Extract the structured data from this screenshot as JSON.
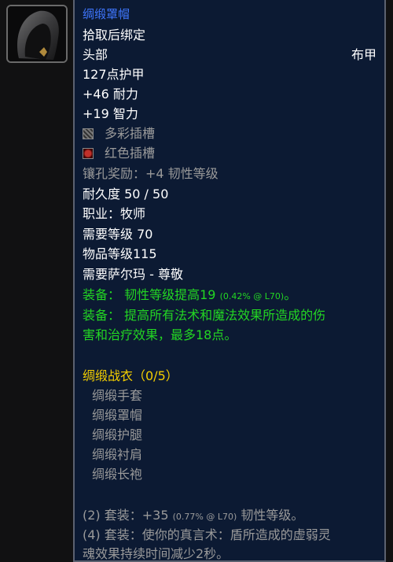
{
  "item": {
    "name": "绸缎罩帽",
    "bind": "拾取后绑定",
    "slot": "头部",
    "armor_type": "布甲",
    "armor": "127点护甲",
    "stamina": "+46 耐力",
    "intellect": "+19 智力",
    "socket1": "多彩插槽",
    "socket2": "红色插槽",
    "socket_bonus": "镶孔奖励：+4 韧性等级",
    "durability": "耐久度 50 / 50",
    "class": "职业：牧师",
    "req_level": "需要等级 70",
    "item_level": "物品等级115",
    "req_rep": "需要萨尔玛 - 尊敬",
    "equip1_prefix": "装备：",
    "equip1_text": "韧性等级提高19",
    "equip1_pct": "(0.42% @ L70)",
    "equip1_suffix": "。",
    "equip2_prefix": "装备：",
    "equip2_line1": "提高所有法术和魔法效果所造成的伤",
    "equip2_line2": "害和治疗效果，最多18点。"
  },
  "set": {
    "title": "绸缎战衣（0/5）",
    "pieces": [
      "绸缎手套",
      "绸缎罩帽",
      "绸缎护腿",
      "绸缎衬肩",
      "绸缎长袍"
    ],
    "bonus1_prefix": "(2) 套装：+35",
    "bonus1_pct": "(0.77% @ L70)",
    "bonus1_suffix": "韧性等级。",
    "bonus2_line1": "(4) 套装：使你的真言术：盾所造成的虚弱灵",
    "bonus2_line2": "魂效果持续时间减少2秒。"
  },
  "colors": {
    "background": "#111112",
    "tooltip_bg": "#0c1a33",
    "name": "#3f77ff",
    "set_bonus_green": "#23d623",
    "set_title_gold": "#f3ce00",
    "inactive_grey": "#9a9a9a"
  }
}
